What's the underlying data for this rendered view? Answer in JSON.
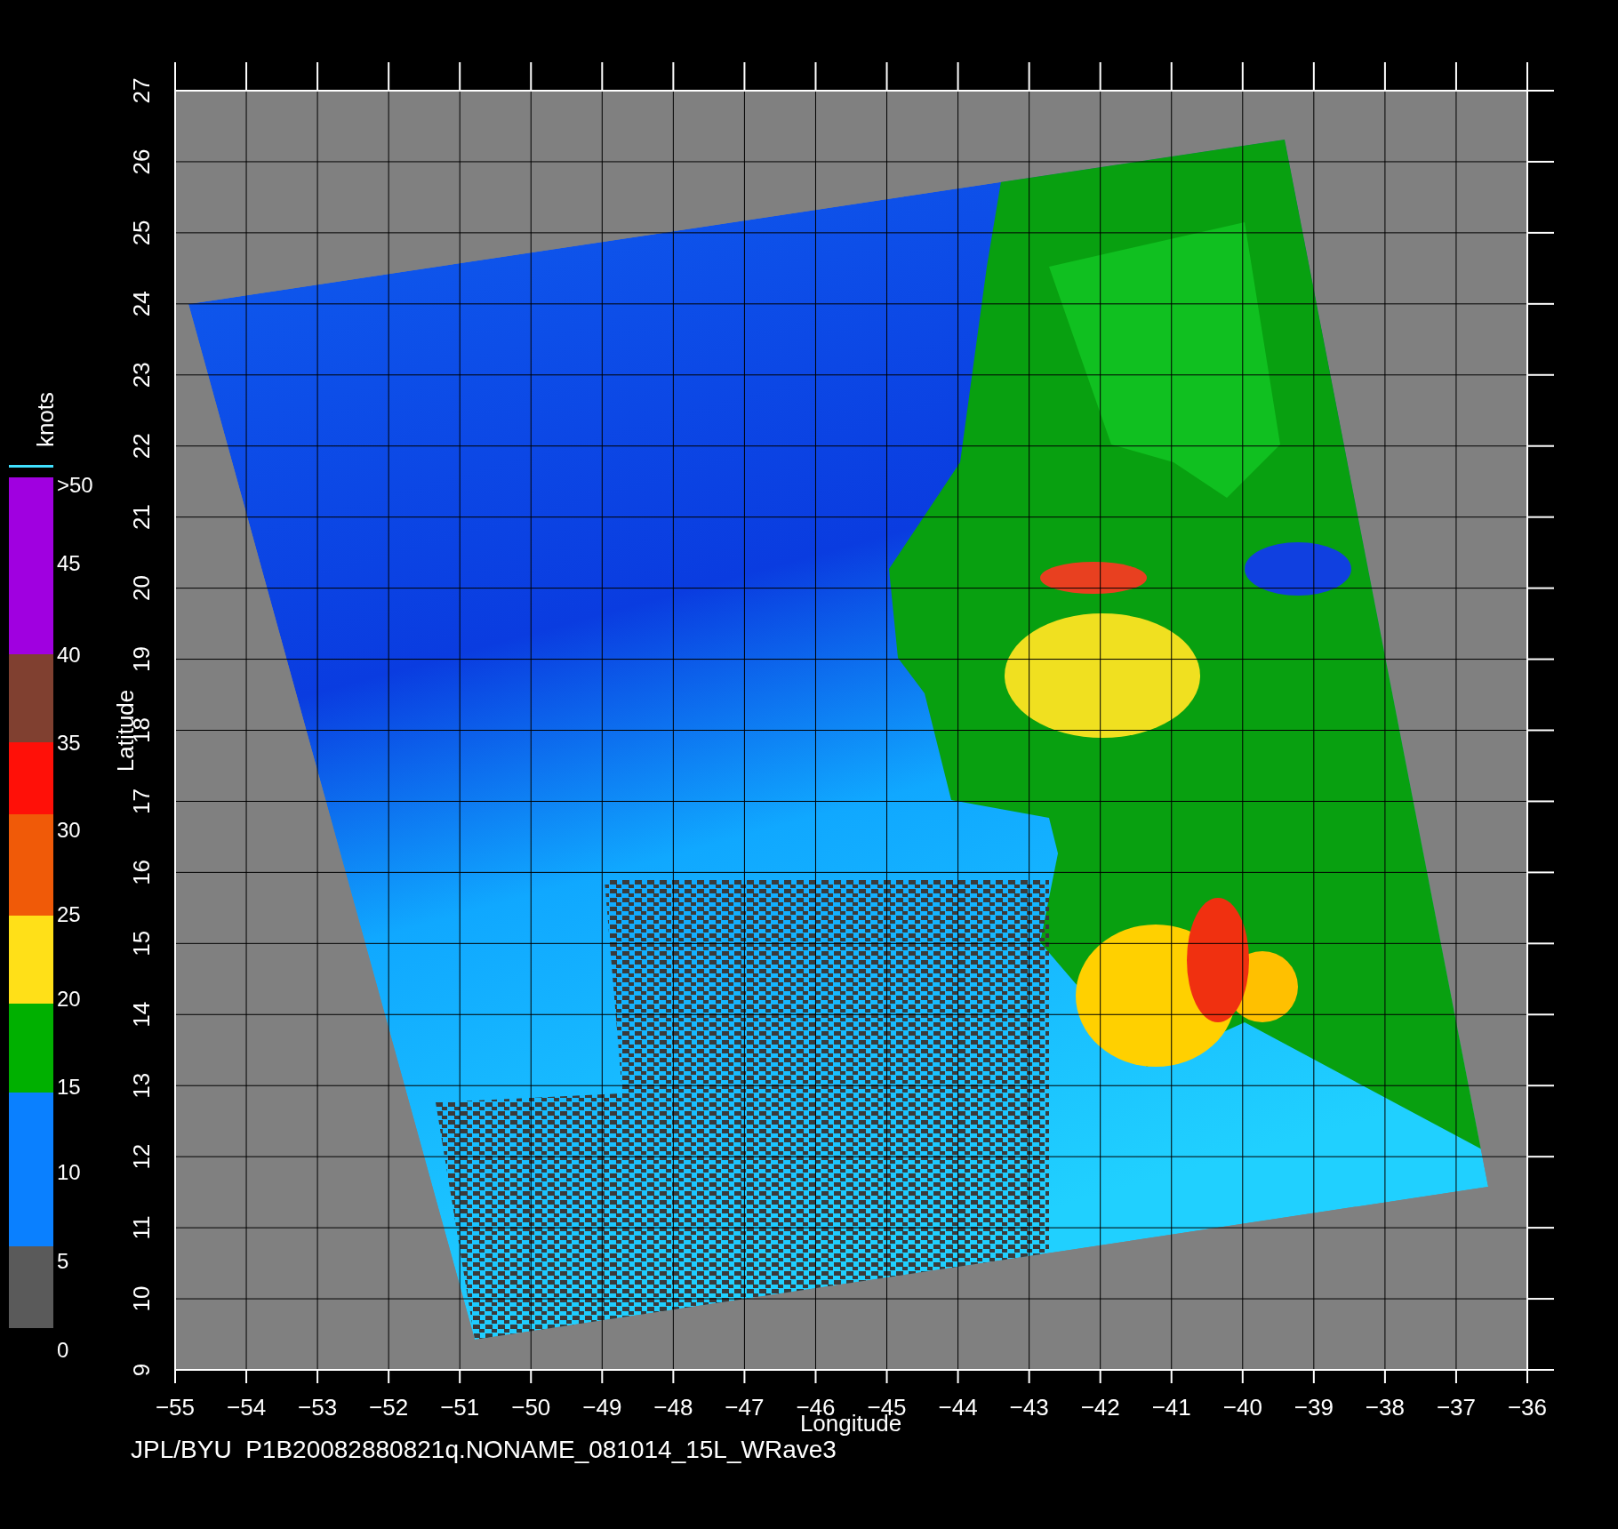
{
  "plot": {
    "x_axis": {
      "label": "Longitude",
      "ticks": [
        "−55",
        "−54",
        "−53",
        "−52",
        "−51",
        "−50",
        "−49",
        "−48",
        "−47",
        "−46",
        "−45",
        "−44",
        "−43",
        "−42",
        "−41",
        "−40",
        "−39",
        "−38",
        "−37",
        "−36"
      ]
    },
    "y_axis": {
      "label": "Latitude",
      "ticks": [
        "9",
        "10",
        "11",
        "12",
        "13",
        "14",
        "15",
        "16",
        "17",
        "18",
        "19",
        "20",
        "21",
        "22",
        "23",
        "24",
        "25",
        "26",
        "27"
      ]
    }
  },
  "colorbar": {
    "title": "knots",
    "bands": [
      {
        "color": "#a000e0"
      },
      {
        "color": "#804030"
      },
      {
        "color": "#ff1008"
      },
      {
        "color": "#f05a08"
      },
      {
        "color": "#ffe018"
      },
      {
        "color": "#00b000"
      },
      {
        "color": "#0a80ff"
      },
      {
        "color": "#5a5a5a"
      }
    ],
    "labels": [
      ">50",
      "45",
      "40",
      "35",
      "30",
      "25",
      "20",
      "15",
      "10",
      "5",
      "0"
    ]
  },
  "footer": "JPL/BYU  P1B20082880821q.NONAME_081014_15L_WRave3"
}
